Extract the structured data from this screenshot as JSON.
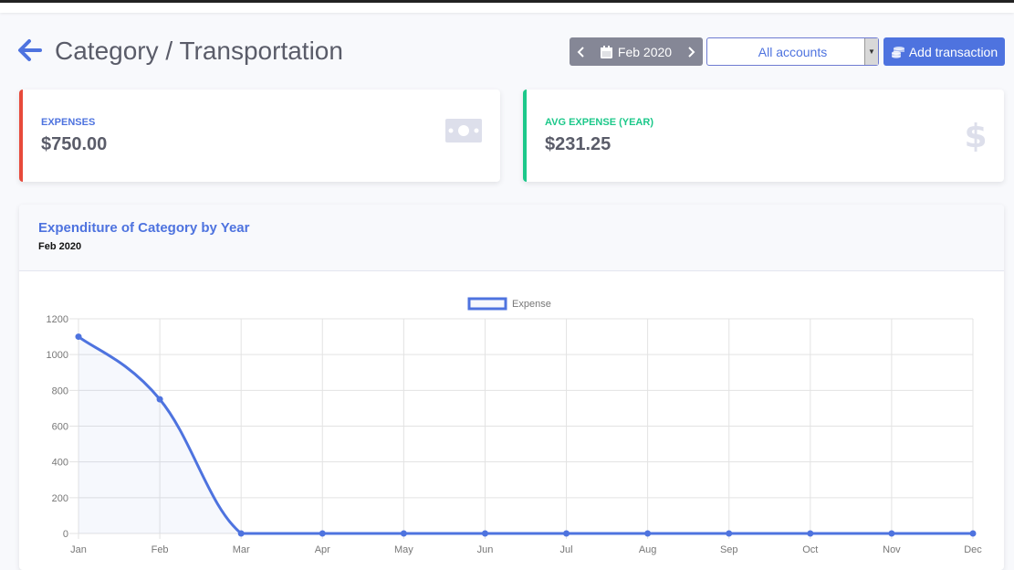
{
  "header": {
    "title": "Category / Transportation",
    "date_label": "Feb 2020",
    "account_select": "All accounts",
    "add_button": "Add transaction"
  },
  "cards": {
    "expenses": {
      "label": "EXPENSES",
      "value": "$750.00"
    },
    "avg_expense": {
      "label": "AVG EXPENSE (YEAR)",
      "value": "$231.25"
    }
  },
  "colors": {
    "primary": "#4e73df",
    "danger": "#e74a3b",
    "success": "#1cc88a",
    "secondary": "#858796"
  },
  "chart_section": {
    "title": "Expenditure of Category by Year",
    "subtitle": "Feb 2020"
  },
  "chart_data": {
    "type": "line",
    "categories": [
      "Jan",
      "Feb",
      "Mar",
      "Apr",
      "May",
      "Jun",
      "Jul",
      "Aug",
      "Sep",
      "Oct",
      "Nov",
      "Dec"
    ],
    "series": [
      {
        "name": "Expense",
        "values": [
          1100,
          750,
          0,
          0,
          0,
          0,
          0,
          0,
          0,
          0,
          0,
          0
        ]
      }
    ],
    "yticks": [
      0,
      200,
      400,
      600,
      800,
      1000,
      1200
    ],
    "ylim": [
      0,
      1200
    ],
    "grid": true,
    "legend": "top-center"
  }
}
